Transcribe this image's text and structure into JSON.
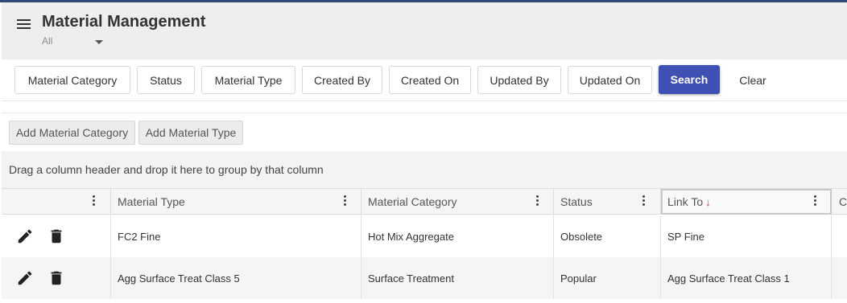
{
  "header": {
    "title": "Material Management",
    "scope_value": "All",
    "icons": {
      "menu": "hamburger-menu-icon",
      "dropdown": "chevron-down-icon"
    }
  },
  "filters": {
    "buttons": [
      "Material Category",
      "Status",
      "Material Type",
      "Created By",
      "Created On",
      "Updated By",
      "Updated On"
    ],
    "search_label": "Search",
    "clear_label": "Clear",
    "accent_color": "#3f51b5"
  },
  "actions": {
    "add_material_category": "Add Material Category",
    "add_material_type": "Add Material Type"
  },
  "grid": {
    "group_hint": "Drag a column header and drop it here to group by that column",
    "columns": [
      "",
      "Material Type",
      "Material Category",
      "Status",
      "Link To",
      "C"
    ],
    "sorted_column": "Link To",
    "sort_direction": "descending",
    "sort_color": "#e0431c",
    "rows": [
      {
        "material_type": "FC2 Fine",
        "material_category": "Hot Mix Aggregate",
        "status": "Obsolete",
        "link_to": "SP Fine"
      },
      {
        "material_type": "Agg Surface Treat Class 5",
        "material_category": "Surface Treatment",
        "status": "Popular",
        "link_to": "Agg Surface Treat Class 1"
      }
    ],
    "row_icons": {
      "edit": "pencil-edit-icon",
      "delete": "trash-delete-icon"
    }
  }
}
